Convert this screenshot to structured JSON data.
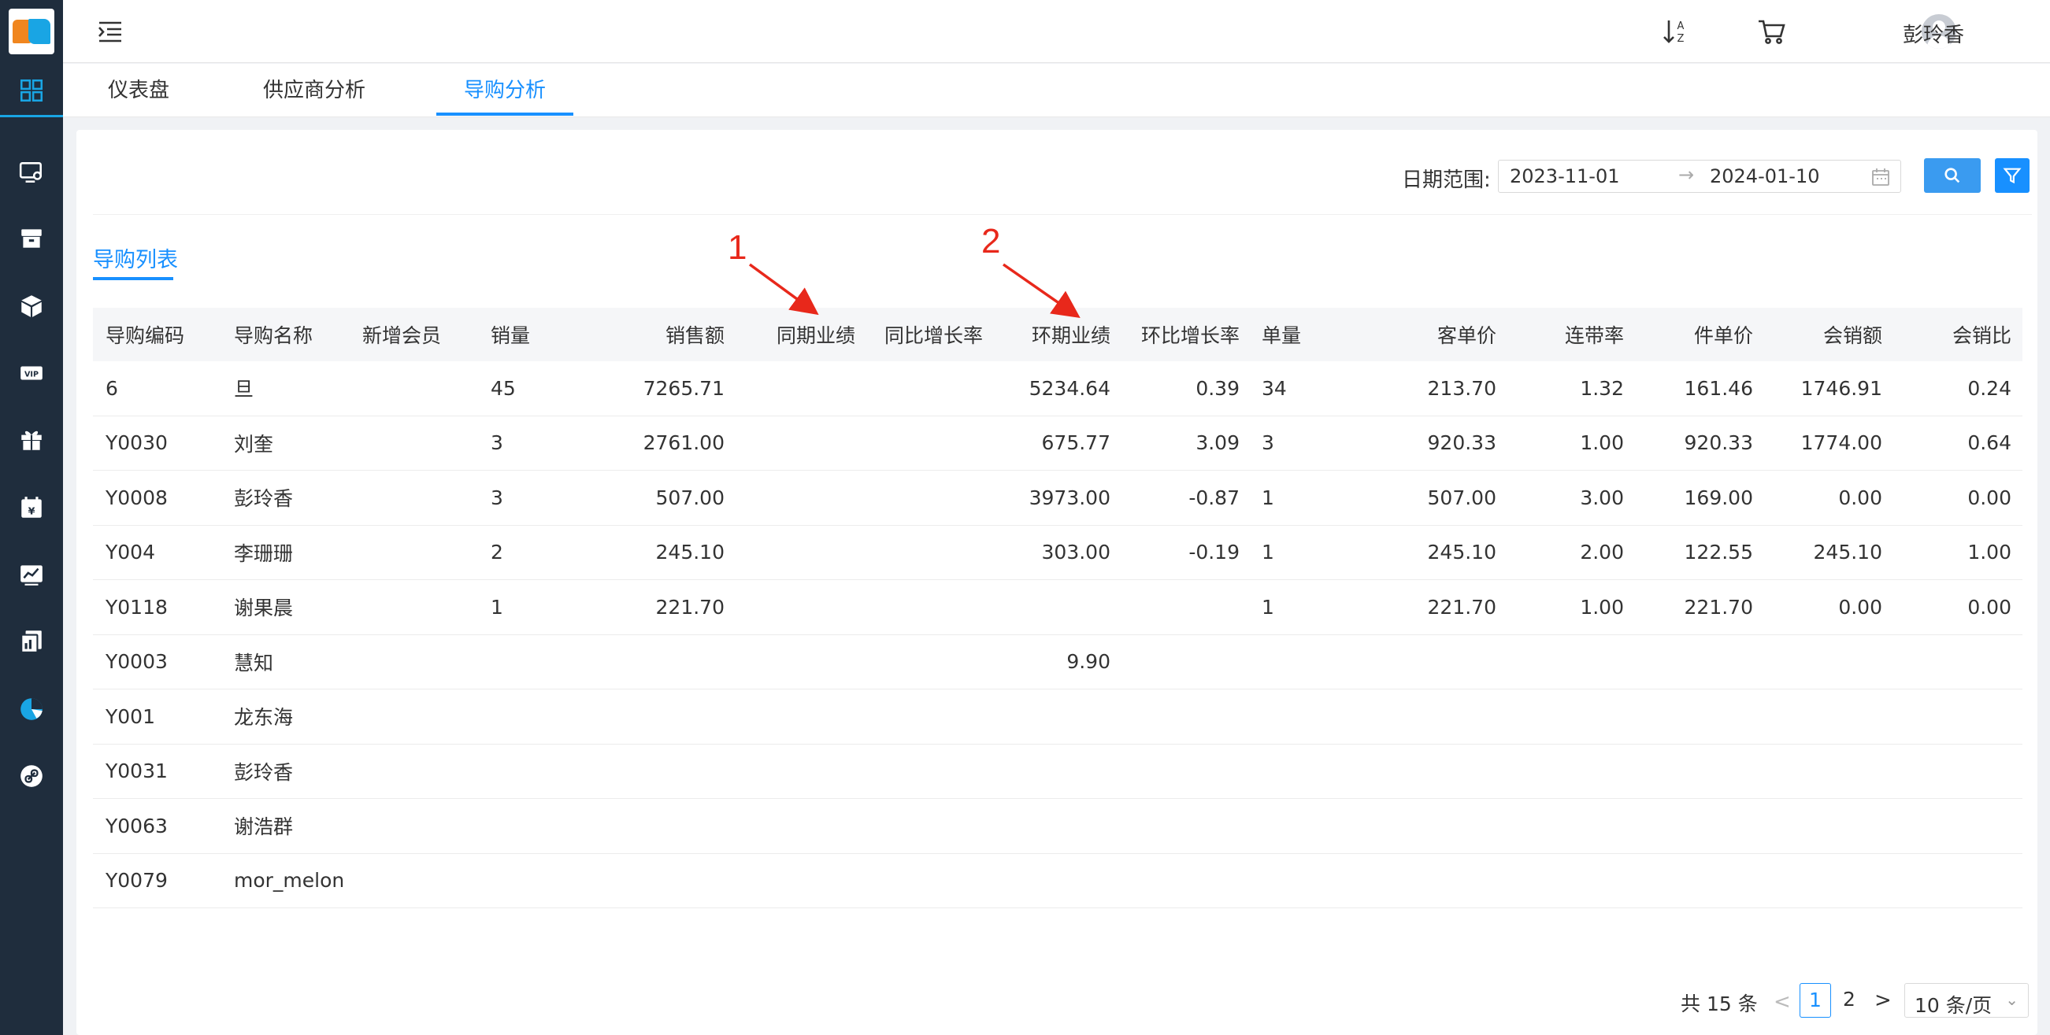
{
  "header": {
    "username": "彭玲香"
  },
  "tabs": [
    {
      "label": "仪表盘"
    },
    {
      "label": "供应商分析"
    },
    {
      "label": "导购分析"
    }
  ],
  "filter": {
    "label": "日期范围:",
    "start": "2023-11-01",
    "arrow": "→",
    "end": "2024-01-10"
  },
  "list_tab": "导购列表",
  "annotations": [
    "1",
    "2"
  ],
  "table": {
    "columns": [
      "导购编码",
      "导购名称",
      "新增会员",
      "销量",
      "销售额",
      "同期业绩",
      "同比增长率",
      "环期业绩",
      "环比增长率",
      "单量",
      "客单价",
      "连带率",
      "件单价",
      "会销额",
      "会销比"
    ],
    "rows": [
      [
        "6",
        "旦",
        "",
        "45",
        "7265.71",
        "",
        "",
        "5234.64",
        "0.39",
        "34",
        "213.70",
        "1.32",
        "161.46",
        "1746.91",
        "0.24"
      ],
      [
        "Y0030",
        "刘奎",
        "",
        "3",
        "2761.00",
        "",
        "",
        "675.77",
        "3.09",
        "3",
        "920.33",
        "1.00",
        "920.33",
        "1774.00",
        "0.64"
      ],
      [
        "Y0008",
        "彭玲香",
        "",
        "3",
        "507.00",
        "",
        "",
        "3973.00",
        "-0.87",
        "1",
        "507.00",
        "3.00",
        "169.00",
        "0.00",
        "0.00"
      ],
      [
        "Y004",
        "李珊珊",
        "",
        "2",
        "245.10",
        "",
        "",
        "303.00",
        "-0.19",
        "1",
        "245.10",
        "2.00",
        "122.55",
        "245.10",
        "1.00"
      ],
      [
        "Y0118",
        "谢果晨",
        "",
        "1",
        "221.70",
        "",
        "",
        "",
        "",
        "1",
        "221.70",
        "1.00",
        "221.70",
        "0.00",
        "0.00"
      ],
      [
        "Y0003",
        "慧知",
        "",
        "",
        "",
        "",
        "",
        "9.90",
        "",
        "",
        "",
        "",
        "",
        "",
        ""
      ],
      [
        "Y001",
        "龙东海",
        "",
        "",
        "",
        "",
        "",
        "",
        "",
        "",
        "",
        "",
        "",
        "",
        ""
      ],
      [
        "Y0031",
        "彭玲香",
        "",
        "",
        "",
        "",
        "",
        "",
        "",
        "",
        "",
        "",
        "",
        "",
        ""
      ],
      [
        "Y0063",
        "谢浩群",
        "",
        "",
        "",
        "",
        "",
        "",
        "",
        "",
        "",
        "",
        "",
        "",
        ""
      ],
      [
        "Y0079",
        "mor_melon",
        "",
        "",
        "",
        "",
        "",
        "",
        "",
        "",
        "",
        "",
        "",
        "",
        ""
      ]
    ]
  },
  "pagination": {
    "total": "共 15 条",
    "pages": [
      "1",
      "2"
    ],
    "page_size": "10 条/页"
  },
  "icons": {
    "sidebar": [
      "dashboard-icon",
      "monitor-settings-icon",
      "archive-box-icon",
      "cube-icon",
      "vip-icon",
      "gift-icon",
      "calendar-yen-icon",
      "trend-chart-icon",
      "report-stack-icon",
      "pie-chart-icon",
      "link-icon"
    ],
    "header": [
      "menu-toggle-icon",
      "sort-az-icon",
      "cart-icon",
      "user-avatar-icon"
    ]
  },
  "colors": {
    "accent": "#1890ff",
    "sidebar": "#1f2d3d",
    "annotation": "#e8281b"
  }
}
